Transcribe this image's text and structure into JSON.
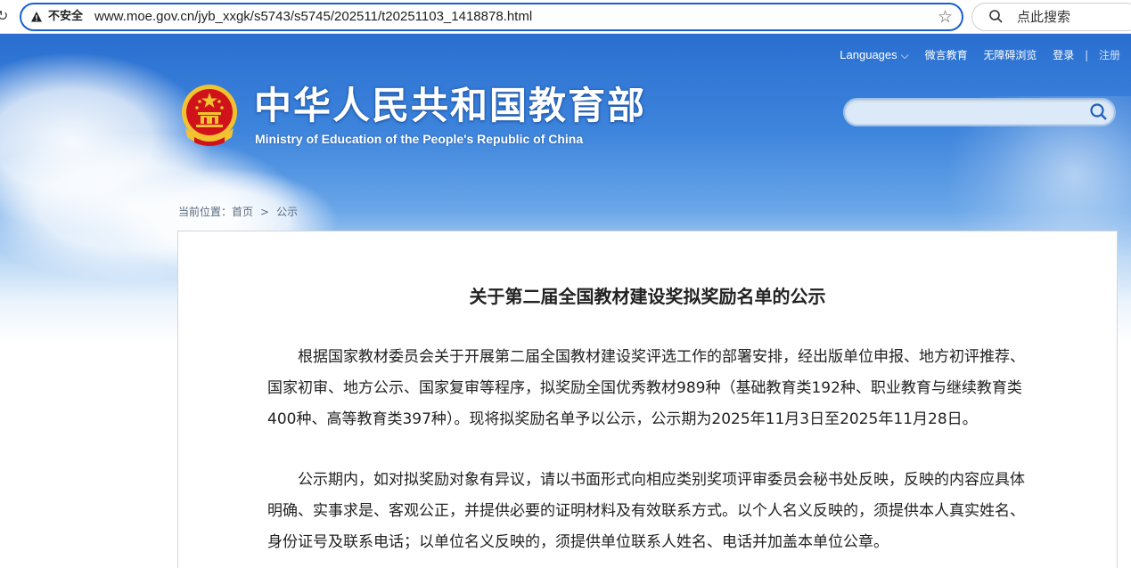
{
  "browser": {
    "security_label": "不安全",
    "url": "www.moe.gov.cn/jyb_xxgk/s5743/s5745/202511/t20251103_1418878.html",
    "search_placeholder": "点此搜索"
  },
  "header": {
    "nav": {
      "languages": "Languages",
      "weiyan": "微言教育",
      "accessibility": "无障碍浏览",
      "login": "登录",
      "register": "注册",
      "separator": "|"
    },
    "site_title_cn": "中华人民共和国教育部",
    "site_title_en": "Ministry of Education of the People's Republic of China"
  },
  "breadcrumb": {
    "prefix": "当前位置：",
    "home": "首页",
    "arrow": ">",
    "current": "公示"
  },
  "article": {
    "title": "关于第二届全国教材建设奖拟奖励名单的公示",
    "paragraphs": [
      "根据国家教材委员会关于开展第二届全国教材建设奖评选工作的部署安排，经出版单位申报、地方初评推荐、国家初审、地方公示、国家复审等程序，拟奖励全国优秀教材989种（基础教育类192种、职业教育与继续教育类400种、高等教育类397种）。现将拟奖励名单予以公示，公示期为2025年11月3日至2025年11月28日。",
      "公示期内，如对拟奖励对象有异议，请以书面形式向相应类别奖项评审委员会秘书处反映，反映的内容应具体明确、实事求是、客观公正，并提供必要的证明材料及有效联系方式。以个人名义反映的，须提供本人真实姓名、身份证号及联系电话；以单位名义反映的，须提供单位联系人姓名、电话并加盖本单位公章。"
    ]
  },
  "colors": {
    "address_border": "#1a5fd0",
    "banner_blue": "#2a6fd0",
    "emblem_red": "#d0121b",
    "emblem_gold": "#f2c230"
  },
  "icons": [
    "reload-icon",
    "warning-icon",
    "star-icon",
    "search-icon",
    "emblem-icon",
    "chevron-down-icon"
  ]
}
